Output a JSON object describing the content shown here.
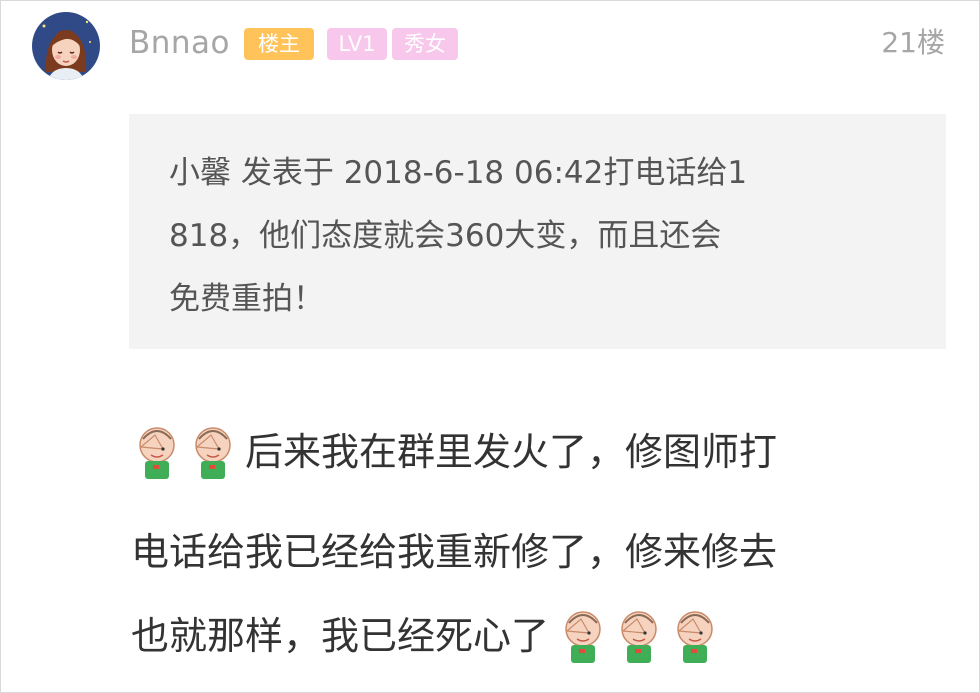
{
  "post": {
    "username": "Bnnao",
    "badges": {
      "owner": "楼主",
      "level": "LV1",
      "title": "秀女"
    },
    "floor": "21楼",
    "avatar_icon": "girl-avatar-icon",
    "badge_colors": {
      "owner": "#ffc35a",
      "level": "#f8c7ec",
      "title": "#f8c7ec"
    }
  },
  "quote": {
    "line1": "小馨 发表于 2018-6-18 06:42打电话给1",
    "line2": "818，他们态度就会360大变，而且还会",
    "line3": "免费重拍！"
  },
  "content": {
    "line1": "后来我在群里发火了，修图师打",
    "line2": "电话给我已经给我重新修了，修来修去",
    "line3": "也就那样，我已经死心了",
    "emoji_icon": "facepalm-emoji-icon"
  }
}
